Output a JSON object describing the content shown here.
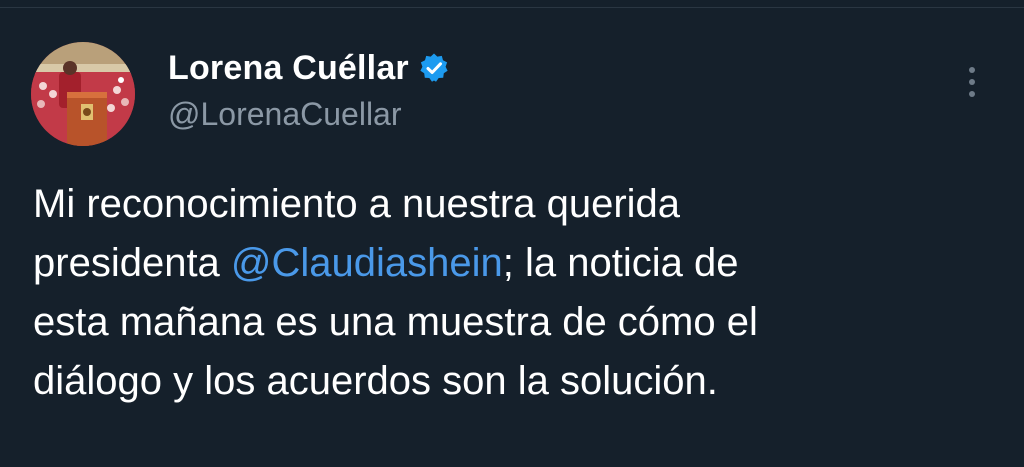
{
  "author": {
    "display_name": "Lorena Cuéllar",
    "handle": "@LorenaCuellar",
    "verified": true
  },
  "tweet": {
    "text_before_mention": "Mi reconocimiento a nuestra querida\npresidenta ",
    "mention": "@Claudiashein",
    "text_after_mention": "; la noticia de\nesta mañana es una muestra de cómo el\ndiálogo y los acuerdos son la solución."
  },
  "icons": {
    "verified": "verified-badge-icon",
    "more": "more-options-icon"
  },
  "colors": {
    "background": "#15202b",
    "text": "#ffffff",
    "secondary_text": "#8b98a5",
    "accent": "#4a99e9"
  }
}
